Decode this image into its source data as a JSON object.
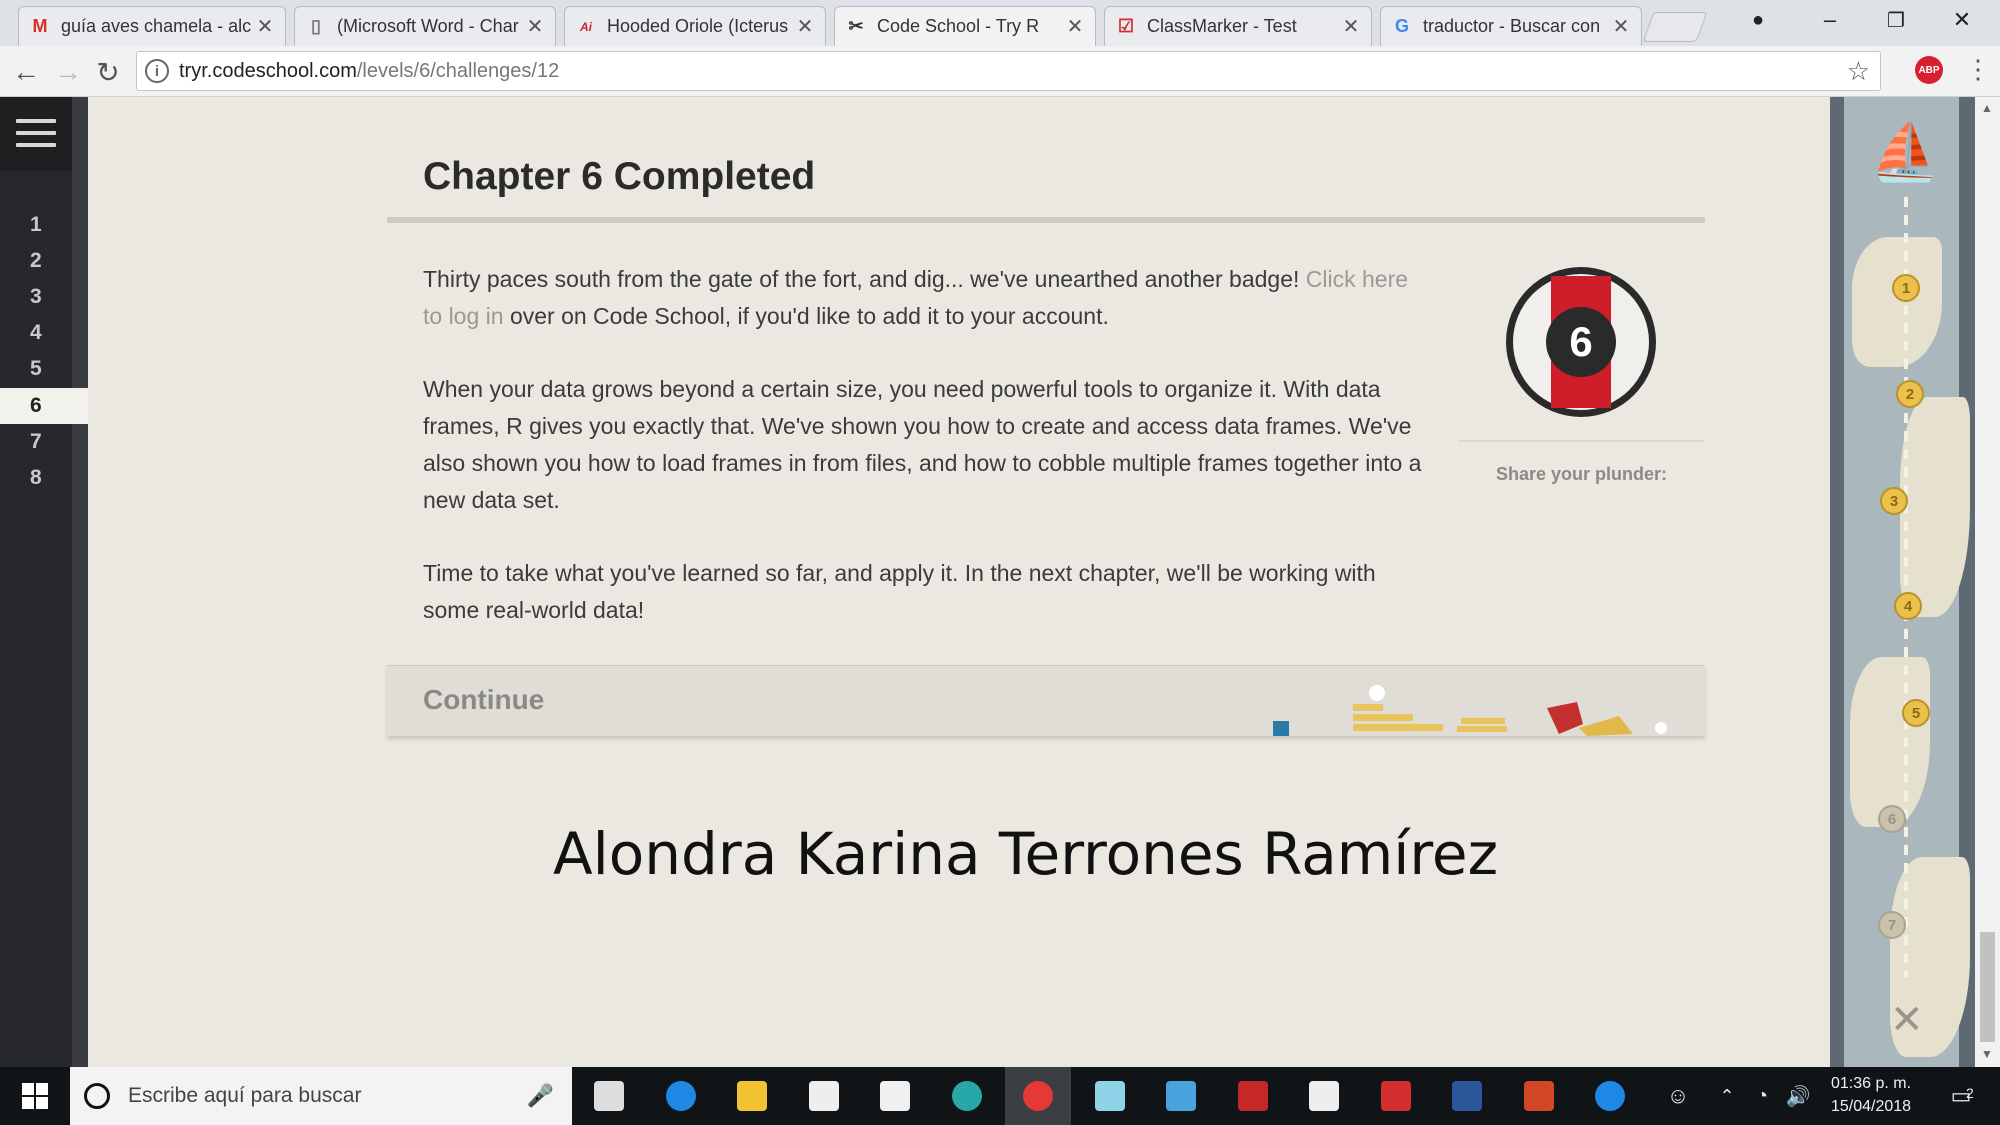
{
  "browser": {
    "tabs": [
      {
        "title": "guía aves chamela - alc",
        "icon": "gmail-icon",
        "color": "#d93025"
      },
      {
        "title": "(Microsoft Word - Char",
        "icon": "document-icon",
        "color": "#777777"
      },
      {
        "title": "Hooded Oriole (Icterus",
        "icon": "site-logo-icon",
        "color": "#c62828"
      },
      {
        "title": "Code School - Try R",
        "icon": "code-school-icon",
        "color": "#333333",
        "active": true
      },
      {
        "title": "ClassMarker - Test",
        "icon": "classmarker-icon",
        "color": "#d32f2f"
      },
      {
        "title": "traductor - Buscar con",
        "icon": "google-icon",
        "color": "#4285f4"
      }
    ],
    "url_host": "tryr.codeschool.com",
    "url_path": "/levels/6/challenges/12",
    "extension_label": "ABP"
  },
  "sidebar": {
    "levels": [
      "1",
      "2",
      "3",
      "4",
      "5",
      "6",
      "7",
      "8"
    ],
    "active_level": "6"
  },
  "main": {
    "title": "Chapter 6 Completed",
    "p1_before": "Thirty paces south from the gate of the fort, and dig... we've unearthed another badge! ",
    "p1_link": "Click here to log in",
    "p1_after": " over on Code School, if you'd like to add it to your account.",
    "p2": "When your data grows beyond a certain size, you need powerful tools to organize it. With data frames, R gives you exactly that. We've shown you how to create and access data frames. We've also shown you how to load frames in from files, and how to cobble multiple frames together into a new data set.",
    "p3": "Time to take what you've learned so far, and apply it. In the next chapter, we'll be working with some real-world data!",
    "badge_number": "6",
    "share_label": "Share your plunder:",
    "continue_label": "Continue",
    "author": "Alondra Karina Terrones Ramírez"
  },
  "map": {
    "points": [
      "1",
      "2",
      "3",
      "4",
      "5",
      "6",
      "7"
    ],
    "completed": 5
  },
  "taskbar": {
    "search_placeholder": "Escribe aquí para buscar",
    "time": "01:36 p. m.",
    "date": "15/04/2018",
    "notification_count": "2",
    "apps": [
      {
        "name": "task-view-icon",
        "color": "#dddddd"
      },
      {
        "name": "edge-icon",
        "color": "#1e88e5"
      },
      {
        "name": "file-explorer-icon",
        "color": "#f2c230"
      },
      {
        "name": "store-icon",
        "color": "#eeeeee"
      },
      {
        "name": "dropbox-icon",
        "color": "#f0f0f0"
      },
      {
        "name": "arduino-icon",
        "color": "#28a7a9"
      },
      {
        "name": "chrome-icon",
        "color": "#e53935"
      },
      {
        "name": "notepad-icon",
        "color": "#8fd3e8"
      },
      {
        "name": "outlook-icon",
        "color": "#4aa3df"
      },
      {
        "name": "mendeley-icon",
        "color": "#c62828"
      },
      {
        "name": "movies-icon",
        "color": "#eeeeee"
      },
      {
        "name": "acrobat-icon",
        "color": "#d32f2f"
      },
      {
        "name": "word-icon",
        "color": "#2b579a"
      },
      {
        "name": "powerpoint-icon",
        "color": "#d24726"
      },
      {
        "name": "help-icon",
        "color": "#1e88e5"
      }
    ]
  }
}
